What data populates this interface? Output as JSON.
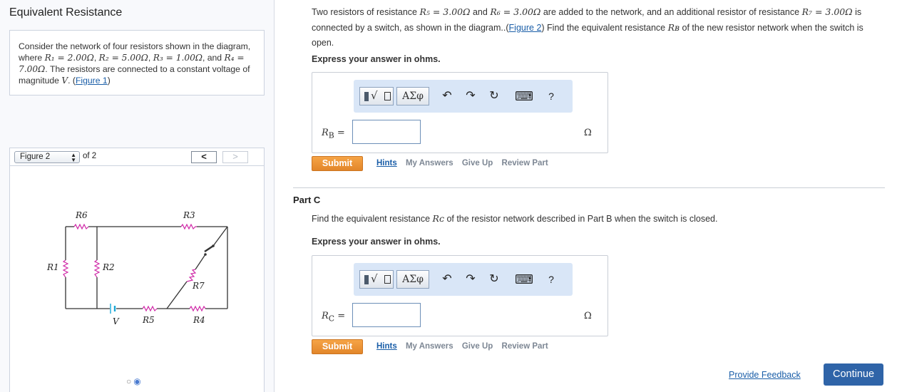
{
  "title": "Equivalent Resistance",
  "problem": {
    "text_a": "Consider the network of four resistors shown in the diagram, where ",
    "r1": "R₁ = 2.00Ω",
    "r2": "R₂ = 5.00Ω",
    "r3": "R₃ = 1.00Ω",
    "text_b": ", and ",
    "r4": "R₄ = 7.00Ω",
    "text_c": ". The resistors are connected to a constant voltage of magnitude ",
    "v": "V",
    "text_d": ". (",
    "fig_link": "Figure 1",
    "text_e": ")"
  },
  "figure": {
    "selected": "Figure 2",
    "of_label": "of 2",
    "prev_label": "<",
    "next_label": ">",
    "labels": {
      "r6": "R6",
      "r3": "R3",
      "r1": "R1",
      "r2": "R2",
      "r7": "R7",
      "v": "V",
      "r5": "R5",
      "r4": "R4"
    },
    "dots": [
      "○",
      "◉"
    ]
  },
  "partB": {
    "q1": "Two resistors of resistance ",
    "r5": "R₅ = 3.00Ω",
    "q2": " and ",
    "r6": "R₆ = 3.00Ω",
    "q3": " are added to the network, and an additional resistor of resistance ",
    "r7": "R₇ = 3.00Ω",
    "q4": " is connected by a switch, as shown in the diagram..(",
    "fig_link": "Figure 2",
    "q5": ") Find the equivalent resistance ",
    "rb": "Rʙ",
    "q6": " of the new resistor network when the switch is open.",
    "instruction": "Express your answer in ohms.",
    "label": "R",
    "sub": "B",
    "eq": " =",
    "value": "",
    "unit": "Ω"
  },
  "toolbar": {
    "greek": "ΑΣφ",
    "undo": "↶",
    "redo": "↷",
    "reset": "↻",
    "keyboard": "⌨",
    "help": "?"
  },
  "buttons": {
    "submit": "Submit",
    "hints": "Hints",
    "my_answers": "My Answers",
    "give_up": "Give Up",
    "review_part": "Review Part"
  },
  "partC": {
    "title": "Part C",
    "q1": "Find the equivalent resistance ",
    "rc": "Rᴄ",
    "q2": " of the resistor network described in Part B when the switch is closed.",
    "instruction": "Express your answer in ohms.",
    "label": "R",
    "sub": "C",
    "eq": " =",
    "value": "",
    "unit": "Ω"
  },
  "footer": {
    "feedback": "Provide Feedback",
    "continue": "Continue"
  }
}
